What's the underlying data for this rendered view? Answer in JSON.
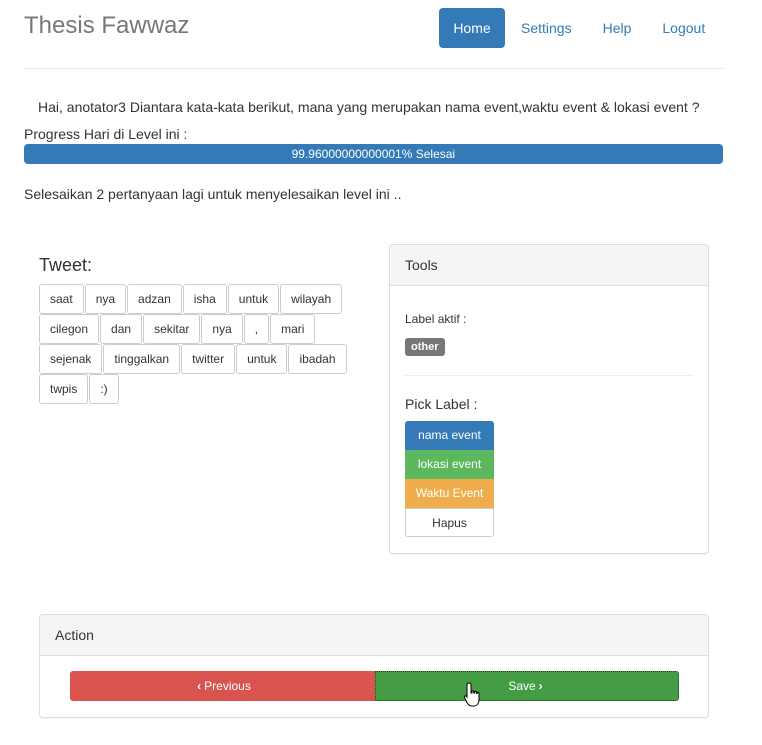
{
  "header": {
    "brand": "Thesis Fawwaz",
    "nav": {
      "home": "Home",
      "settings": "Settings",
      "help": "Help",
      "logout": "Logout"
    }
  },
  "question": "Hai, anotator3 Diantara kata-kata berikut, mana yang merupakan nama event,waktu event & lokasi event ?",
  "progress": {
    "label": "Progress Hari di Level ini :",
    "value_percent": 99.96000000000001,
    "text": "99.96000000000001% Selesai"
  },
  "remaining_text": "Selesaikan 2 pertanyaan lagi untuk menyelesaikan level ini ..",
  "tweet": {
    "title": "Tweet:",
    "tokens": [
      "saat",
      "nya",
      "adzan",
      "isha",
      "untuk",
      "wilayah",
      "cilegon",
      "dan",
      "sekitar",
      "nya",
      ",",
      "mari",
      "sejenak",
      "tinggalkan",
      "twitter",
      "untuk",
      "ibadah",
      "twpis",
      ":)"
    ]
  },
  "tools": {
    "heading": "Tools",
    "active_label_caption": "Label aktif :",
    "active_label": "other",
    "pick_label_caption": "Pick Label :",
    "labels": {
      "nama_event": "nama event",
      "lokasi_event": "lokasi event",
      "waktu_event": "Waktu Event",
      "hapus": "Hapus"
    }
  },
  "action": {
    "heading": "Action",
    "previous": "Previous",
    "save": "Save"
  },
  "colors": {
    "primary": "#337ab7",
    "success": "#5cb85c",
    "warning": "#f0ad4e",
    "danger": "#d9534f",
    "default_badge": "#777777"
  }
}
